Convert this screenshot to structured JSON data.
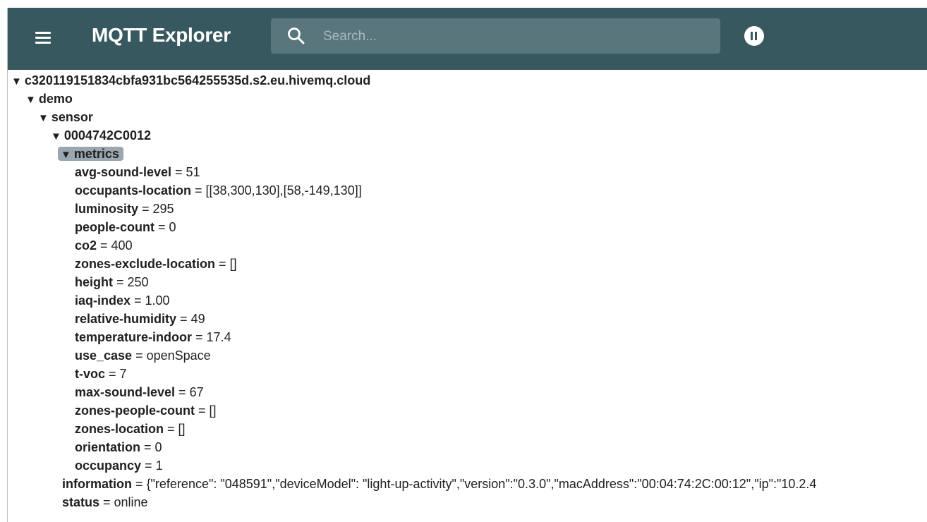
{
  "app": {
    "title": "MQTT Explorer"
  },
  "search": {
    "placeholder": "Search..."
  },
  "tree": {
    "root": "c320119151834cbfa931bc564255535d.s2.eu.hivemq.cloud",
    "demo": "demo",
    "sensor": "sensor",
    "device": "0004742C0012",
    "metrics": "metrics",
    "metrics_items": [
      {
        "key": "avg-sound-level",
        "value": "51"
      },
      {
        "key": "occupants-location",
        "value": "[[38,300,130],[58,-149,130]]"
      },
      {
        "key": "luminosity",
        "value": "295"
      },
      {
        "key": "people-count",
        "value": "0"
      },
      {
        "key": "co2",
        "value": "400"
      },
      {
        "key": "zones-exclude-location",
        "value": "[]"
      },
      {
        "key": "height",
        "value": "250"
      },
      {
        "key": "iaq-index",
        "value": "1.00"
      },
      {
        "key": "relative-humidity",
        "value": "49"
      },
      {
        "key": "temperature-indoor",
        "value": "17.4"
      },
      {
        "key": "use_case",
        "value": "openSpace"
      },
      {
        "key": "t-voc",
        "value": "7"
      },
      {
        "key": "max-sound-level",
        "value": "67"
      },
      {
        "key": "zones-people-count",
        "value": "[]"
      },
      {
        "key": "zones-location",
        "value": "[]"
      },
      {
        "key": "orientation",
        "value": "0"
      },
      {
        "key": "occupancy",
        "value": "1"
      }
    ],
    "device_items": [
      {
        "key": "information",
        "value": "{\"reference\": \"048591\",\"deviceModel\": \"light-up-activity\",\"version\":\"0.3.0\",\"macAddress\":\"00:04:74:2C:00:12\",\"ip\":\"10.2.4"
      },
      {
        "key": "status",
        "value": "online"
      }
    ],
    "separator": " = "
  },
  "colors": {
    "appbar": "#38585f",
    "search_bg": "#5a767d",
    "selected": "#9aa6b0"
  },
  "icons": {
    "menu": "hamburger-menu-icon",
    "search": "search-icon",
    "pause": "pause-icon",
    "expanded": "triangle-down-icon"
  }
}
